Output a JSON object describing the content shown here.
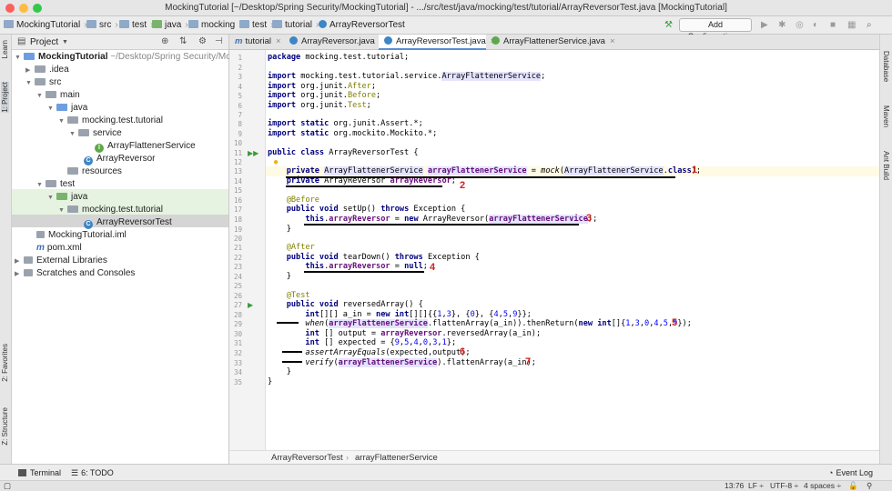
{
  "window": {
    "title": "MockingTutorial [~/Desktop/Spring Security/MockingTutorial] - .../src/test/java/mocking/test/tutorial/ArrayReversorTest.java [MockingTutorial]"
  },
  "nav": {
    "crumbs": [
      "MockingTutorial",
      "src",
      "test",
      "java",
      "mocking",
      "test",
      "tutorial",
      "ArrayReversorTest"
    ],
    "add_config_label": "Add Configuration..."
  },
  "left_tabs": {
    "learn": "Learn",
    "project": "1: Project",
    "favorites": "2: Favorites",
    "structure": "Z: Structure"
  },
  "right_tabs": {
    "database": "Database",
    "maven": "Maven",
    "ant": "Ant Build"
  },
  "project_panel": {
    "title": "Project",
    "tree": [
      {
        "label": "MockingTutorial",
        "extra": "~/Desktop/Spring Security/Mo"
      },
      {
        "label": ".idea"
      },
      {
        "label": "src"
      },
      {
        "label": "main"
      },
      {
        "label": "java"
      },
      {
        "label": "mocking.test.tutorial"
      },
      {
        "label": "service"
      },
      {
        "label": "ArrayFlattenerService"
      },
      {
        "label": "ArrayReversor"
      },
      {
        "label": "resources"
      },
      {
        "label": "test"
      },
      {
        "label": "java"
      },
      {
        "label": "mocking.test.tutorial"
      },
      {
        "label": "ArrayReversorTest"
      },
      {
        "label": "MockingTutorial.iml"
      },
      {
        "label": "pom.xml"
      },
      {
        "label": "External Libraries"
      },
      {
        "label": "Scratches and Consoles"
      }
    ]
  },
  "tabs": [
    "tutorial",
    "ArrayReversor.java",
    "ArrayReversorTest.java",
    "ArrayFlattenerService.java"
  ],
  "editor": {
    "line_numbers": [
      "1",
      "2",
      "3",
      "4",
      "5",
      "6",
      "7",
      "8",
      "9",
      "10",
      "11",
      "12",
      "13",
      "14",
      "15",
      "16",
      "17",
      "18",
      "19",
      "20",
      "21",
      "22",
      "23",
      "24",
      "25",
      "26",
      "27",
      "28",
      "29",
      "30",
      "31",
      "32",
      "33",
      "34",
      "35"
    ],
    "markers": [
      "1",
      "2",
      "3",
      "4",
      "5",
      "6",
      "7"
    ]
  },
  "breadcrumbs": [
    "ArrayReversorTest",
    "arrayFlattenerService"
  ],
  "bottom": {
    "terminal": "Terminal",
    "todo": "6: TODO",
    "event_log": "Event Log"
  },
  "status": {
    "position": "13:76",
    "line_sep": "LF ÷",
    "encoding": "UTF-8 ÷",
    "indent": "4 spaces ÷"
  }
}
